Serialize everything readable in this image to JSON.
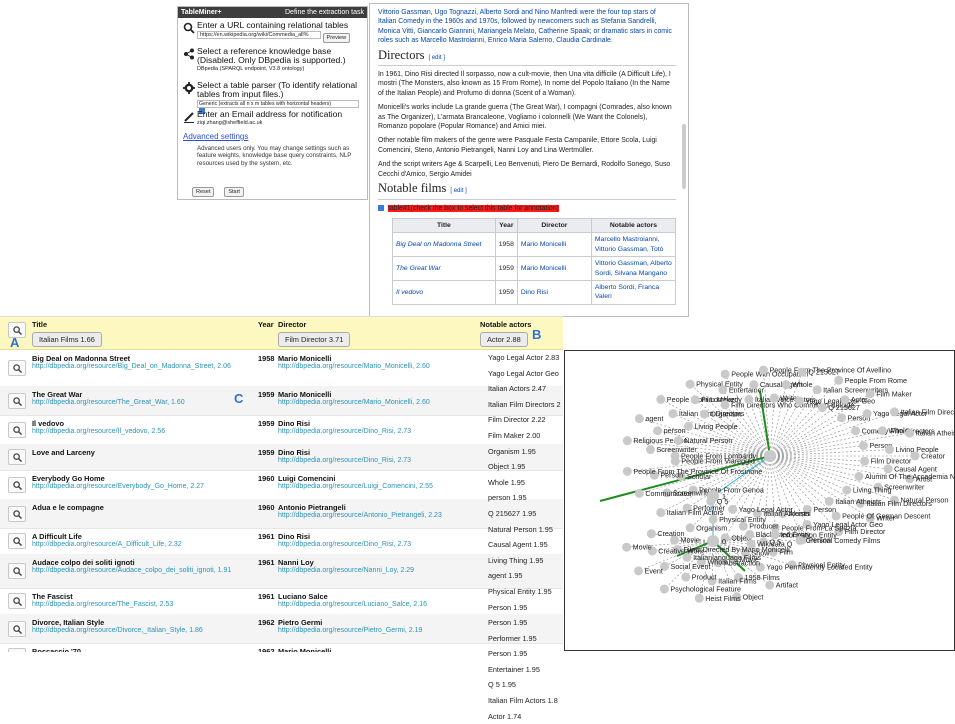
{
  "tableminer": {
    "title": "TableMiner+",
    "subtitle": "Define the extraction task",
    "url_heading": "Enter a URL containing relational tables",
    "url_value": "https://en.wikipedia.org/wiki/Commedia_all%",
    "preview_button": "Preview",
    "kb_heading": "Select a reference knowledge base (Disabled. Only DBpedia is supported.)",
    "kb_value": "DBpedia (SPARQL endpoint, V3.8 ontology)",
    "parser_heading": "Select a table parser (To identify relational tables from input files.)",
    "parser_value": "Generic (extracts all n x m tables with horizontal headers)",
    "email_heading": "Enter an Email address for notification",
    "email_value": "ziqi.zhang@sheffield.ac.uk",
    "advanced_link": "Advanced settings",
    "advanced_text": "Advanced users only. You may change settings such as feature weights, knowledge base query constraints, NLP resources used by the system, etc.",
    "reset_button": "Reset",
    "start_button": "Start"
  },
  "wiki": {
    "p1": "Vittorio Gassman, Ugo Tognazzi, Alberto Sordi and Nino Manfredi were the four top stars of Italian Comedy in the 1960s and 1970s, followed by newcomers such as Stefania Sandrelli, Monica Vitti, Giancarlo Giannini, Mariangela Melato, Catherine Spaak; or dramatic stars in comic roles such as Marcello Mastroianni, Enrico Maria Salerno, Claudia Cardinale.",
    "h_directors": "Directors",
    "edit": "[ edit ]",
    "p2": "In 1961, Dino Risi directed Il sorpasso, now a cult-movie, then Una vita difficile (A Difficult Life), I mostri (The Monsters, also known as 15 From Rome), In nome del Popolo Italiano (In the Name of the Italian People) and Profumo di donna (Scent of a Woman).",
    "p3": "Monicelli's works include La grande guerra (The Great War), I compagni (Comrades, also known as The Organizer), L'armata Brancaleone, Vogliamo i colonnelli (We Want the Colonels), Romanzo popolare (Popular Romance) and Amici miei.",
    "p4": "Other notable film makers of the genre were Pasquale Festa Campanile, Ettore Scola, Luigi Comencini, Steno, Antonio Pietrangeli, Nanni Loy and Lina Wertmüller.",
    "p5": "And the script writers Age & Scarpelli, Leo Benvenuti, Piero De Bernardi, Rodolfo Sonego, Suso Cecchi d'Amico, Sergio Amidei",
    "h_notable": "Notable films",
    "select_label": "table#1(check the box to select this table for annotation)",
    "table_headers": [
      "Title",
      "Year",
      "Director",
      "Notable actors"
    ],
    "table_rows": [
      [
        "Big Deal on Madonna Street",
        "1958",
        "Mario Monicelli",
        "Marcello Mastroianni, Vittorio Gassman, Totò"
      ],
      [
        "The Great War",
        "1959",
        "Mario Monicelli",
        "Vittorio Gassman, Alberto Sordi, Silvana Mangano"
      ],
      [
        "Il vedovo",
        "1959",
        "Dino Risi",
        "Alberto Sordi, Franca Valeri"
      ]
    ]
  },
  "main_table": {
    "headers": {
      "title": "Title",
      "year": "Year",
      "director": "Director",
      "actors": "Notable actors"
    },
    "header_pills": {
      "title": "Italian Films 1.66",
      "director": "Film Director 3.71",
      "actors": "Actor 2.88"
    },
    "markers": {
      "a": "A",
      "b": "B",
      "c": "C"
    },
    "rows": [
      {
        "title": "Big Deal on Madonna Street",
        "title_uri": "http://dbpedia.org/resource/Big_Deal_on_Madonna_Street, 2.06",
        "year": "1958",
        "director": "Mario Monicelli",
        "director_uri": "http://dbpedia.org/resource/Mario_Monicelli, 2.60"
      },
      {
        "title": "The Great War",
        "title_uri": "http://dbpedia.org/resource/The_Great_War, 1.60",
        "year": "1959",
        "director": "Mario Monicelli",
        "director_uri": "http://dbpedia.org/resource/Mario_Monicelli, 2.60"
      },
      {
        "title": "Il vedovo",
        "title_uri": "http://dbpedia.org/resource/Il_vedovo, 2.56",
        "year": "1959",
        "director": "Dino Risi",
        "director_uri": "http://dbpedia.org/resource/Dino_Risi, 2.73"
      },
      {
        "title": "Love and Larceny",
        "title_uri": "",
        "year": "1959",
        "director": "Dino Risi",
        "director_uri": "http://dbpedia.org/resource/Dino_Risi, 2.73"
      },
      {
        "title": "Everybody Go Home",
        "title_uri": "http://dbpedia.org/resource/Everybody_Go_Home, 2.27",
        "year": "1960",
        "director": "Luigi Comencini",
        "director_uri": "http://dbpedia.org/resource/Luigi_Comencini, 2.55"
      },
      {
        "title": "Adua e le compagne",
        "title_uri": "",
        "year": "1960",
        "director": "Antonio Pietrangeli",
        "director_uri": "http://dbpedia.org/resource/Antonio_Pietrangeli, 2.23"
      },
      {
        "title": "A Difficult Life",
        "title_uri": "http://dbpedia.org/resource/A_Difficult_Life, 2.32",
        "year": "1961",
        "director": "Dino Risi",
        "director_uri": "http://dbpedia.org/resource/Dino_Risi, 2.73"
      },
      {
        "title": "Audace colpo dei soliti ignoti",
        "title_uri": "http://dbpedia.org/resource/Audace_colpo_dei_soliti_ignoti, 1.91",
        "year": "1961",
        "director": "Nanni Loy",
        "director_uri": "http://dbpedia.org/resource/Nanni_Loy, 2.29"
      },
      {
        "title": "The Fascist",
        "title_uri": "http://dbpedia.org/resource/The_Fascist, 2.53",
        "year": "1961",
        "director": "Luciano Salce",
        "director_uri": "http://dbpedia.org/resource/Luciano_Salce, 2.16"
      },
      {
        "title": "Divorce, Italian Style",
        "title_uri": "http://dbpedia.org/resource/Divorce,_Italian_Style, 1.86",
        "year": "1962",
        "director": "Pietro Germi",
        "director_uri": "http://dbpedia.org/resource/Pietro_Germi, 2.19"
      },
      {
        "title": "Boccaccio '70",
        "title_uri": "",
        "year": "1962",
        "director": "Mario Monicelli",
        "director_uri": "http://dbpedia.org/resource/Mario_Monicelli, 2.60"
      }
    ]
  },
  "candidates": [
    "Yago Legal Actor 2.83",
    "Yago Legal Actor Geo",
    "Italian Actors 2.47",
    "Italian Film Directors 2",
    "Film Director 2.22",
    "Film Maker 2.00",
    "Organism 1.95",
    "Object 1.95",
    "Whole 1.95",
    "person 1.95",
    "Q 215627 1.95",
    "Natural Person 1.95",
    "Causal Agent 1.95",
    "Living Thing 1.95",
    "agent 1.95",
    "Physical Entity 1.95",
    "Person 1.95",
    "Person 1.95",
    "Performer 1.95",
    "Person 1.95",
    "Entertainer 1.95",
    "Q 5 1.95",
    "Italian Film Actors 1.8",
    "Actor 1.74"
  ],
  "graph": {
    "hub_labels": [
      "1",
      "0"
    ],
    "labels": [
      "People From Lombardy",
      "Screenwriter",
      "Religious Person",
      "Natural Person",
      "person",
      "agent",
      "Living People",
      "Italian Film Directors",
      "People From Lombardy",
      "Organism",
      "Film Maker",
      "Physical Entity",
      "Film Directors Who Committed Suicide",
      "Entertainer",
      "People With Occupation",
      "Italian Voice Actors",
      "Causal Agent",
      "People From The Province Of Avellino",
      "Writer",
      "Whole",
      "Q 215627",
      "Yago Legal Actor Geo",
      "Italian Screenwriters",
      "People From Rome",
      "Q 215627",
      "Actor",
      "Film Maker",
      "Person",
      "Yago Legal Actor",
      "Italian Film Directors",
      "Comedy Film Directors",
      "Whole",
      "Italian Atheists",
      "Person",
      "Living People",
      "Creator",
      "Film Director",
      "Causal Agent",
      "Artist",
      "Alumni Of The Accademia N",
      "Screenwriter",
      "Natural Person",
      "Living Thing",
      "Italian Film Directors",
      "Writer",
      "Italian Atheists",
      "People Of German Descent",
      "Film Director",
      "Person",
      "Yago Legal Actor Geo",
      "Person",
      "Alumni",
      "People From La Spezia",
      "Q 5",
      "Italian Atheists",
      "Producer",
      "Object",
      "Yago Legal Actor",
      "Physical Entity",
      "Organism",
      "Q 5",
      "Performer",
      "Italian Film Actors",
      "People From Genoa",
      "Screenwriter",
      "Communicator",
      "Scholar",
      "Person",
      "People From The Province Of Frosinone",
      "People From Viareggio",
      "Blacklisted Entity",
      "Information Entity",
      "Criminal Comedy Films",
      "Wikidata Q",
      "Film",
      "Physical Entity",
      "Show",
      "Yago Permanently Located Entity",
      "Artifact",
      "Movie",
      "1958 Films",
      "Object",
      "Abstraction",
      "Italian Films",
      "Heist Films",
      "Whole",
      "Product",
      "Psychological Feature",
      "Italianlanguage Films",
      "Social Event",
      "Event",
      "Films Directed By Mario Monicelli",
      "Creative Work",
      "Movie",
      "Movie",
      "Creation"
    ]
  }
}
